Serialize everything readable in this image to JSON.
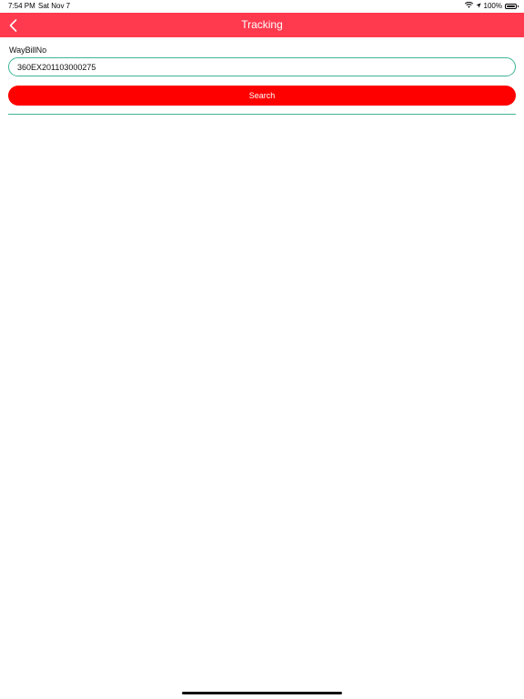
{
  "status_bar": {
    "time": "7:54 PM",
    "date": "Sat Nov 7",
    "battery": "100%",
    "icons": [
      "wifi-icon",
      "location-arrow-icon",
      "battery-icon"
    ]
  },
  "nav": {
    "title": "Tracking",
    "back_icon": "chevron-left-icon"
  },
  "form": {
    "label": "WayBillNo",
    "input_value": "360EX201103000275",
    "search_label": "Search"
  },
  "colors": {
    "nav_background": "#ff3a4e",
    "button_background": "#ff0000",
    "accent_border": "#3fb596"
  }
}
